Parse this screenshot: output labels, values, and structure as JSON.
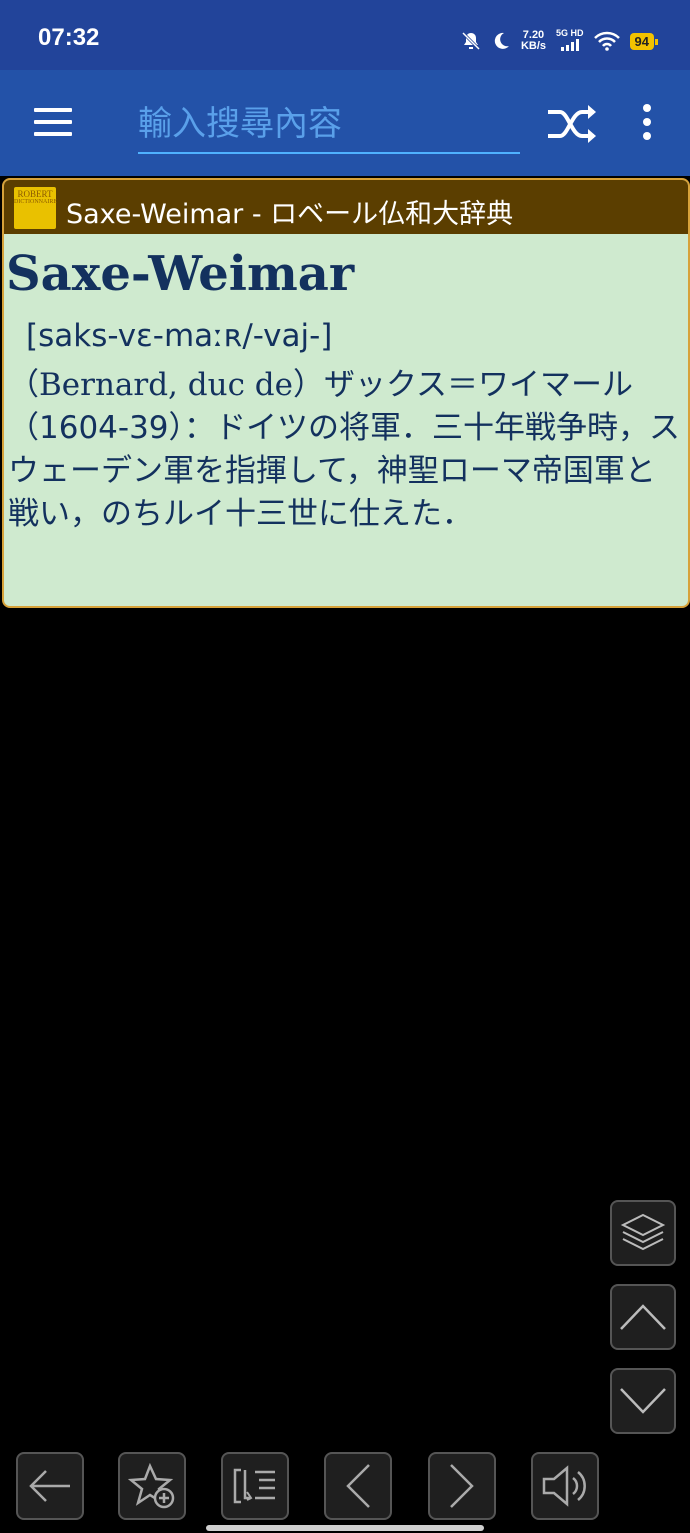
{
  "status_bar": {
    "time": "07:32",
    "net_speed_value": "7.20",
    "net_speed_unit": "KB/s",
    "network": "5G HD",
    "battery": "94"
  },
  "toolbar": {
    "search_placeholder": "輸入搜尋內容"
  },
  "entry": {
    "card_title": "Saxe-Weimar - ロベール仏和大辞典",
    "logo_text": "ROBERT",
    "headword": "Saxe-Weimar",
    "pronunciation": "[saks-vɛ-maːʀ/-vaj-]",
    "definition_part1": "（Bernard, duc de）",
    "definition_part2": "ザックス＝ワイマール（1604-39）：ドイツの将軍．三十年戦争時，スウェーデン軍を指揮して，神聖ローマ帝国軍と戦い，のちルイ十三世に仕えた．"
  },
  "colors": {
    "status_bar": "#22449a",
    "toolbar": "#2352a8",
    "card_header": "#5b3e00",
    "card_body": "#cfeacf",
    "card_border": "#d7a23a",
    "text": "#13315e"
  },
  "icons": {
    "right_column": [
      "layers-icon",
      "chevron-up-icon",
      "chevron-down-icon"
    ],
    "bottom_bar": [
      "back-arrow-icon",
      "add-favorite-icon",
      "list-icon",
      "previous-icon",
      "next-icon",
      "speaker-icon"
    ]
  }
}
